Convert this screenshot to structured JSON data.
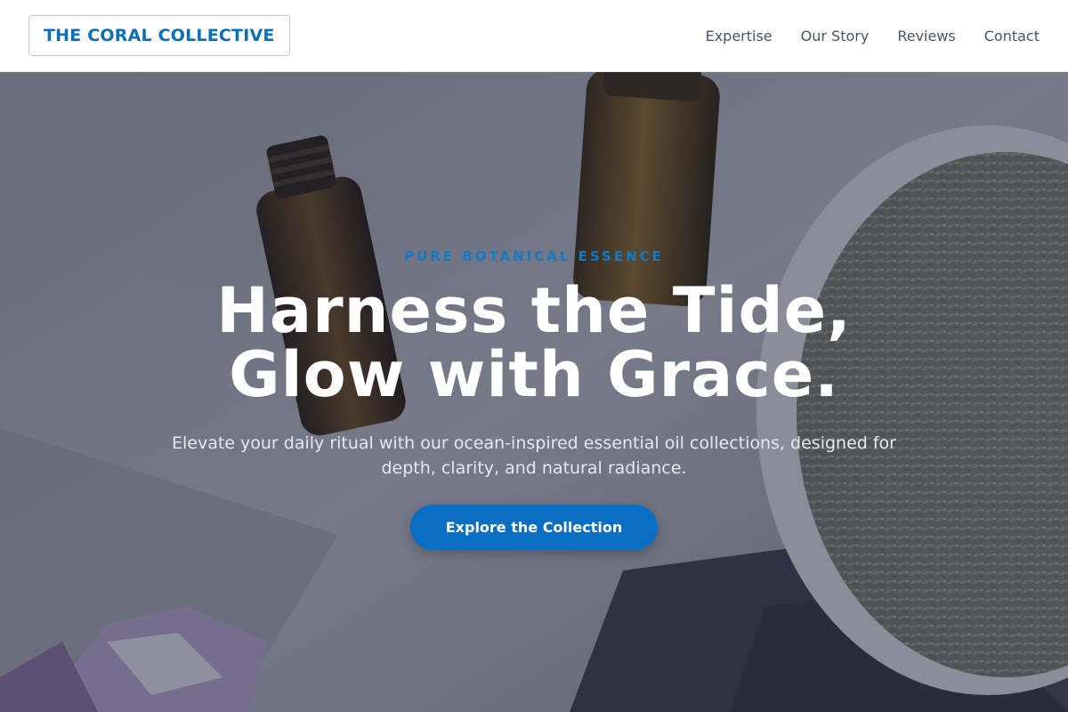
{
  "header": {
    "logo_text": "THE CORAL COLLECTIVE",
    "nav": [
      {
        "label": "Expertise"
      },
      {
        "label": "Our Story"
      },
      {
        "label": "Reviews"
      },
      {
        "label": "Contact"
      }
    ]
  },
  "hero": {
    "eyebrow": "PURE BOTANICAL ESSENCE",
    "headline_line1": "Harness the Tide,",
    "headline_line2": "Glow with Grace.",
    "subtext": "Elevate your daily ritual with our ocean-inspired essential oil collections, designed for depth, clarity, and natural radiance.",
    "cta_label": "Explore the Collection"
  },
  "colors": {
    "brand": "#0b6fb8",
    "cta": "#0a6fc2",
    "nav_text": "#4a5563"
  },
  "icons": {
    "background_image": "essential-oil-bottles-lavender-image"
  }
}
